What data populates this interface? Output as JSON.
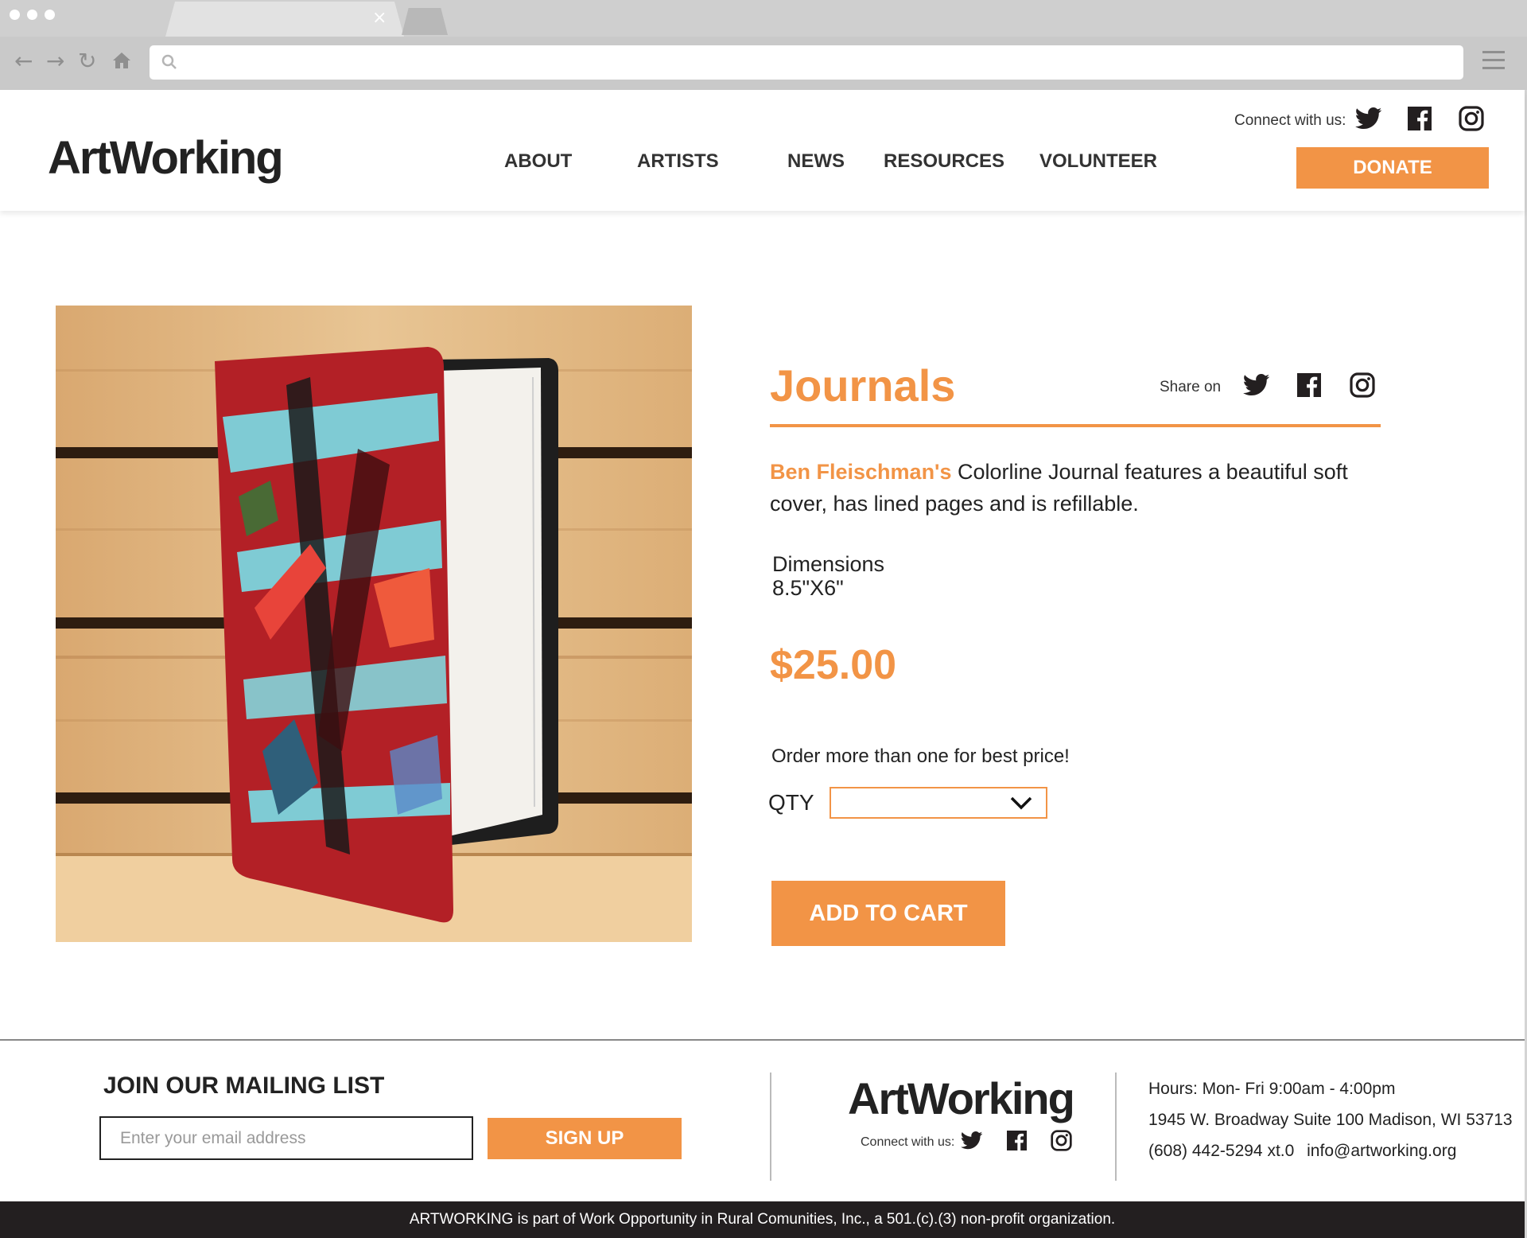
{
  "browser": {
    "url": "",
    "close_tab_label": "×"
  },
  "header": {
    "logo": "ArtWorking",
    "connect_label": "Connect with us:",
    "nav": [
      "ABOUT",
      "ARTISTS",
      "NEWS",
      "RESOURCES",
      "VOLUNTEER"
    ],
    "donate_label": "DONATE"
  },
  "product": {
    "title": "Journals",
    "share_label": "Share on",
    "artist": "Ben Fleischman's",
    "description": " Colorline Journal features a beautiful soft cover, has lined pages and is refillable.",
    "dimensions_label": "Dimensions",
    "dimensions_value": "8.5\"X6\"",
    "price": "$25.00",
    "order_note": "Order more than one for best price!",
    "qty_label": "QTY",
    "qty_value": "",
    "add_to_cart_label": "ADD TO CART"
  },
  "footer": {
    "mailing_title": "JOIN OUR MAILING LIST",
    "email_placeholder": "Enter your email address",
    "signup_label": "SIGN UP",
    "logo": "ArtWorking",
    "connect_label": "Connect with us:",
    "hours": "Hours: Mon- Fri 9:00am - 4:00pm",
    "address": "1945 W. Broadway Suite 100 Madison, WI 53713",
    "phone": "(608) 442-5294 xt.0",
    "email": "info@artworking.org",
    "legal": "ARTWORKING is part of Work Opportunity in Rural Comunities, Inc., a 501.(c).(3) non-profit organization."
  },
  "colors": {
    "accent": "#f29446",
    "dark": "#231f20",
    "text": "#222222"
  },
  "icons": [
    "search-icon",
    "back-arrow-icon",
    "forward-arrow-icon",
    "reload-icon",
    "home-icon",
    "menu-icon",
    "twitter-icon",
    "facebook-icon",
    "instagram-icon",
    "chevron-down-icon"
  ]
}
